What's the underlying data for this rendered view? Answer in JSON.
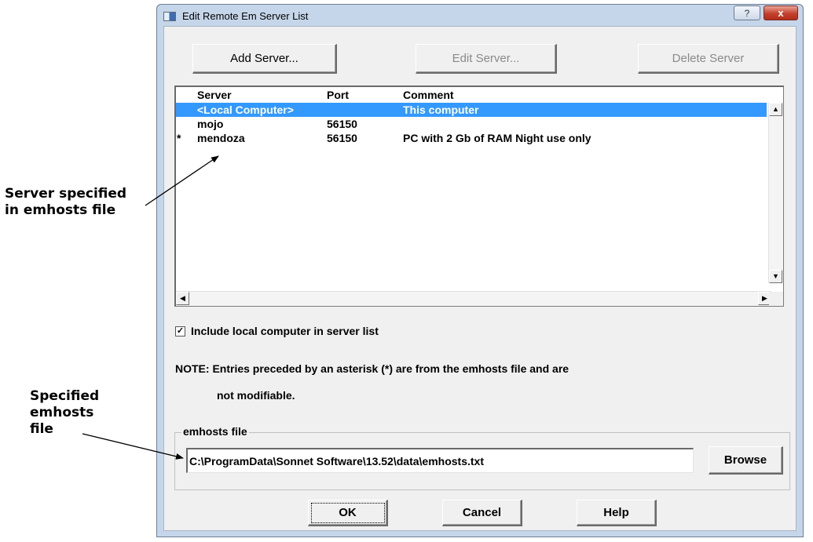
{
  "window": {
    "title": "Edit Remote Em Server List",
    "help_glyph": "?",
    "close_glyph": "x"
  },
  "toolbar": {
    "add_label": "Add Server...",
    "edit_label": "Edit Server...",
    "delete_label": "Delete Server"
  },
  "table": {
    "columns": [
      "Server",
      "Port",
      "Comment"
    ],
    "rows": [
      {
        "marker": "",
        "server": "<Local Computer>",
        "port": "",
        "comment": "This computer",
        "selected": true
      },
      {
        "marker": "",
        "server": "mojo",
        "port": "56150",
        "comment": "",
        "selected": false
      },
      {
        "marker": "*",
        "server": "mendoza",
        "port": "56150",
        "comment": "PC with 2 Gb of RAM Night use only",
        "selected": false
      }
    ]
  },
  "include_local": {
    "label": "Include local computer in server list",
    "checked": true,
    "check_glyph": "✓"
  },
  "note": {
    "line1": "NOTE: Entries preceded by an asterisk (*) are from the emhosts file and are",
    "line2": "not modifiable."
  },
  "emhosts": {
    "group_label": "emhosts file",
    "path": "C:\\ProgramData\\Sonnet Software\\13.52\\data\\emhosts.txt",
    "browse_label": "Browse"
  },
  "footer": {
    "ok_label": "OK",
    "cancel_label": "Cancel",
    "help_label": "Help"
  },
  "callouts": {
    "server_specified": "Server specified\nin emhosts file",
    "specified_file": "Specified\nemhosts\nfile"
  },
  "colors": {
    "selection": "#3399ff",
    "titlebar": "#c6d6ea",
    "dialog_face": "#f0f0f0"
  },
  "icons": {
    "scroll_up": "▲",
    "scroll_down": "▼",
    "scroll_left": "◀",
    "scroll_right": "▶"
  }
}
